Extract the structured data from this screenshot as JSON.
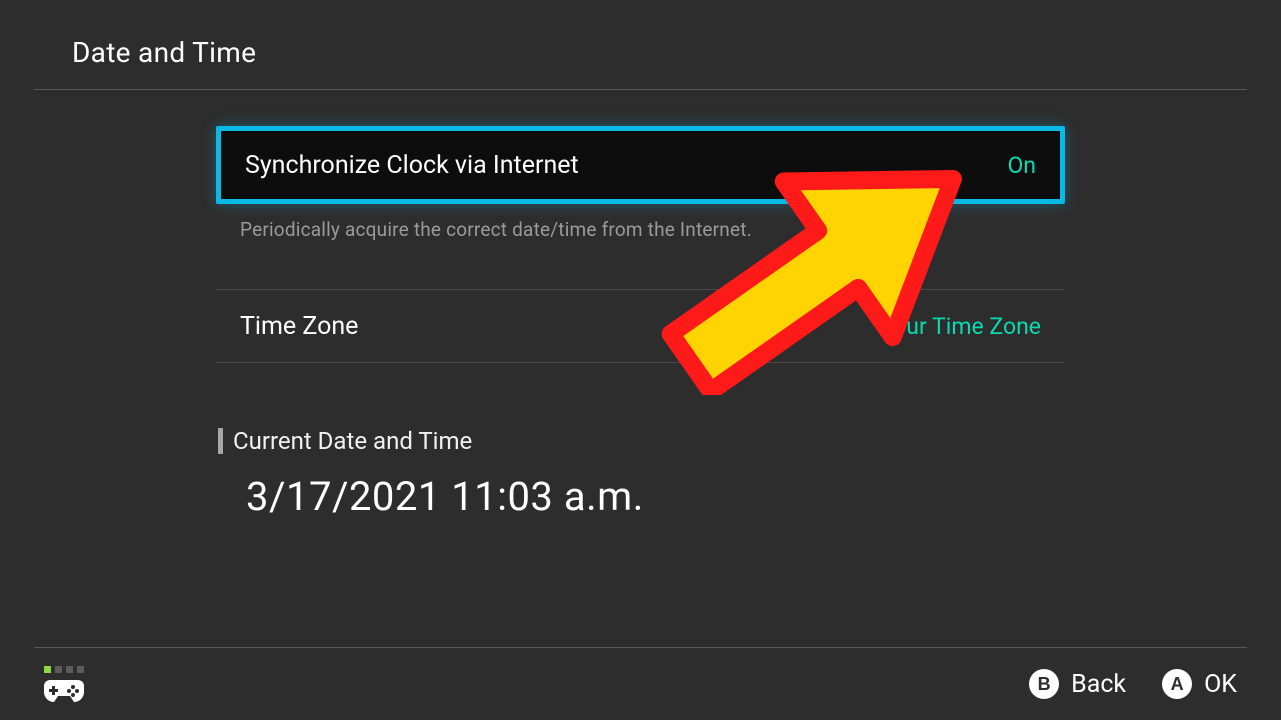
{
  "header": {
    "title": "Date and Time"
  },
  "settings": {
    "sync": {
      "label": "Synchronize Clock via Internet",
      "value": "On",
      "description": "Periodically acquire the correct date/time from the Internet."
    },
    "timezone": {
      "label": "Time Zone",
      "value": "Your Time Zone"
    }
  },
  "current": {
    "section_title": "Current Date and Time",
    "value": "3/17/2021 11:03 a.m."
  },
  "footer": {
    "back": {
      "button": "B",
      "label": "Back"
    },
    "ok": {
      "button": "A",
      "label": "OK"
    }
  }
}
